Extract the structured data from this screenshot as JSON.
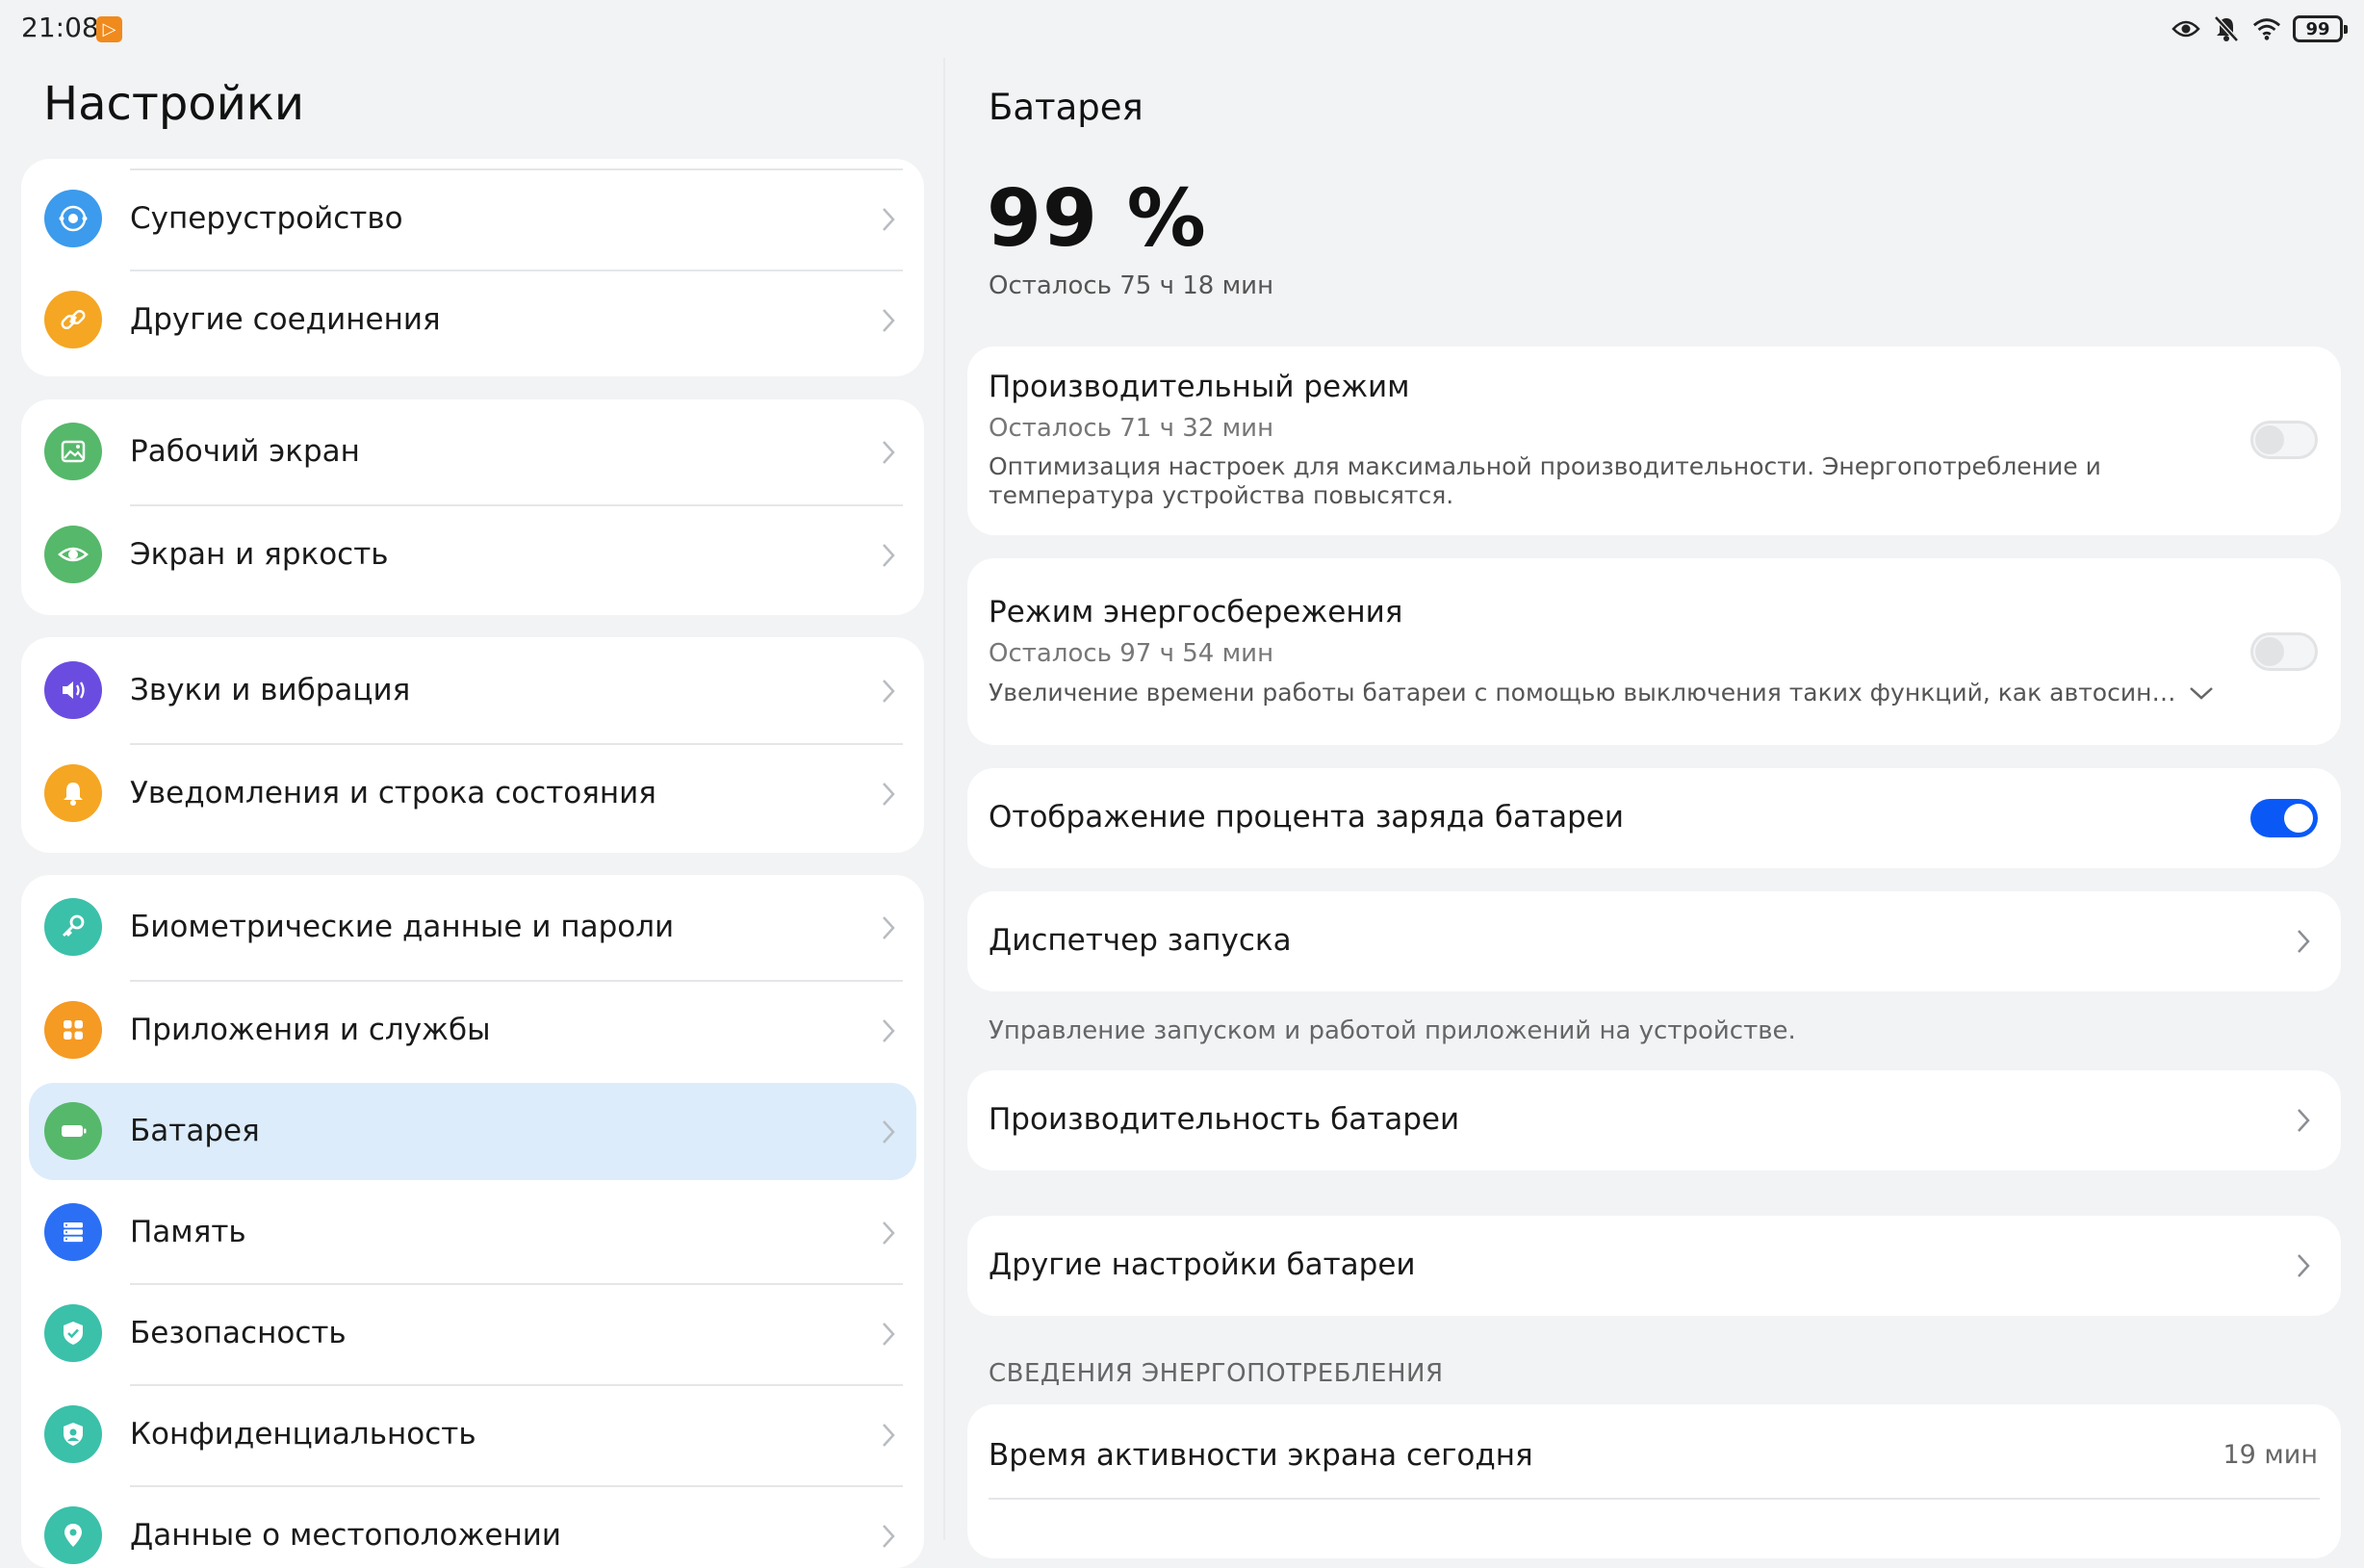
{
  "status_bar": {
    "time": "21:08",
    "battery_level": "99",
    "icons": [
      "eye-comfort-icon",
      "mute-icon",
      "wifi-icon",
      "battery-icon"
    ]
  },
  "settings": {
    "title": "Настройки",
    "items": [
      {
        "id": "superdevice",
        "label": "Суперустройство",
        "icon": "superdevice-icon",
        "color": "#3c9bec"
      },
      {
        "id": "other-connections",
        "label": "Другие соединения",
        "icon": "link-icon",
        "color": "#f5a623"
      },
      {
        "id": "home-screen",
        "label": "Рабочий экран",
        "icon": "wallpaper-icon",
        "color": "#56b86b"
      },
      {
        "id": "display",
        "label": "Экран и яркость",
        "icon": "eye-icon",
        "color": "#56b86b"
      },
      {
        "id": "sounds",
        "label": "Звуки и вибрация",
        "icon": "speaker-icon",
        "color": "#6a4de0"
      },
      {
        "id": "notifications",
        "label": "Уведомления и строка состояния",
        "icon": "bell-icon",
        "color": "#f5a623"
      },
      {
        "id": "biometrics",
        "label": "Биометрические данные и пароли",
        "icon": "key-icon",
        "color": "#3bc0aa"
      },
      {
        "id": "apps",
        "label": "Приложения и службы",
        "icon": "apps-icon",
        "color": "#f59a23"
      },
      {
        "id": "battery",
        "label": "Батарея",
        "icon": "battery-icon",
        "color": "#56b86b"
      },
      {
        "id": "storage",
        "label": "Память",
        "icon": "storage-icon",
        "color": "#2b6ff5"
      },
      {
        "id": "security",
        "label": "Безопасность",
        "icon": "shield-icon",
        "color": "#3bc0aa"
      },
      {
        "id": "privacy",
        "label": "Конфиденциальность",
        "icon": "privacy-icon",
        "color": "#3bc0aa"
      },
      {
        "id": "location",
        "label": "Данные о местоположении",
        "icon": "location-icon",
        "color": "#3bc0aa"
      }
    ]
  },
  "battery": {
    "title": "Батарея",
    "percent": "99 %",
    "remaining": "Осталось 75 ч 18 мин",
    "performance_mode": {
      "title": "Производительный режим",
      "remaining": "Осталось 71 ч 32 мин",
      "description": "Оптимизация настроек для максимальной производительности. Энергопотребление и температура устройства повысятся.",
      "enabled": false
    },
    "power_saving": {
      "title": "Режим энергосбережения",
      "remaining": "Осталось 97 ч 54 мин",
      "description": "Увеличение времени работы батареи с помощью выключения таких функций, как автосинхронизация",
      "enabled": false
    },
    "show_percentage": {
      "title": "Отображение процента заряда батареи",
      "enabled": true
    },
    "launch_manager": {
      "title": "Диспетчер запуска",
      "note": "Управление запуском и работой приложений на устройстве."
    },
    "battery_performance": {
      "title": "Производительность батареи"
    },
    "more_settings": {
      "title": "Другие настройки батареи"
    },
    "consumption_section": {
      "header": "СВЕДЕНИЯ ЭНЕРГОПОТРЕБЛЕНИЯ",
      "screen_time": {
        "title": "Время активности экрана сегодня",
        "value": "19 мин"
      }
    }
  },
  "colors": {
    "accent": "#0a59f7",
    "selected_bg": "#dcecfb",
    "page_bg": "#f1f3f5"
  }
}
